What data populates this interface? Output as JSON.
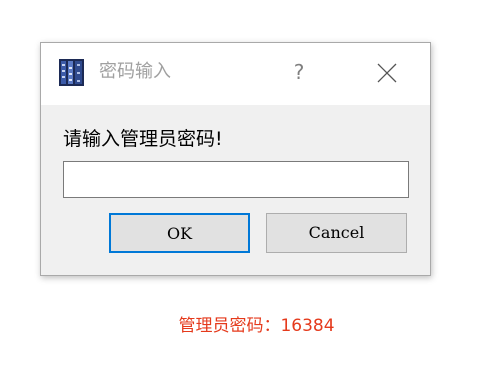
{
  "dialog": {
    "title": "密码输入",
    "help_label": "?",
    "prompt": "请输入管理员密码!",
    "password_value": "",
    "ok_label": "OK",
    "cancel_label": "Cancel"
  },
  "caption": {
    "text": "管理员密码：16384"
  },
  "colors": {
    "caption": "#e53a1c",
    "ok_focus_border": "#0078d7",
    "dialog_background": "#f0f0f0",
    "title_text": "#a0a0a0"
  },
  "icons": {
    "app": "app-icon",
    "close": "close-icon"
  }
}
